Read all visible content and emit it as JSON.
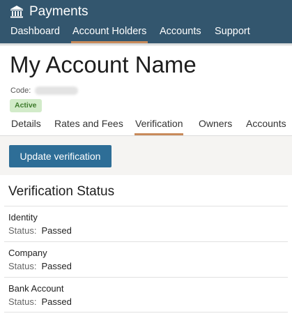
{
  "app": {
    "title": "Payments",
    "icon": "bank-icon"
  },
  "nav": {
    "items": [
      {
        "label": "Dashboard",
        "active": false
      },
      {
        "label": "Account Holders",
        "active": true
      },
      {
        "label": "Accounts",
        "active": false
      },
      {
        "label": "Support",
        "active": false
      }
    ]
  },
  "page": {
    "title": "My Account Name",
    "code_label": "Code:",
    "status_badge": "Active"
  },
  "tabs": [
    {
      "label": "Details",
      "active": false
    },
    {
      "label": "Rates and Fees",
      "active": false
    },
    {
      "label": "Verification",
      "active": true
    },
    {
      "label": "Owners",
      "active": false
    },
    {
      "label": "Accounts",
      "active": false
    }
  ],
  "actions": {
    "update_label": "Update verification"
  },
  "verification": {
    "title": "Verification Status",
    "status_label": "Status:",
    "items": [
      {
        "name": "Identity",
        "status": "Passed"
      },
      {
        "name": "Company",
        "status": "Passed"
      },
      {
        "name": "Bank Account",
        "status": "Passed"
      }
    ]
  },
  "colors": {
    "header_bg": "#33566e",
    "accent_underline": "#c88a5a",
    "button_bg": "#2e6e97",
    "badge_bg": "#d2ebc9",
    "badge_text": "#3e7b2c"
  }
}
